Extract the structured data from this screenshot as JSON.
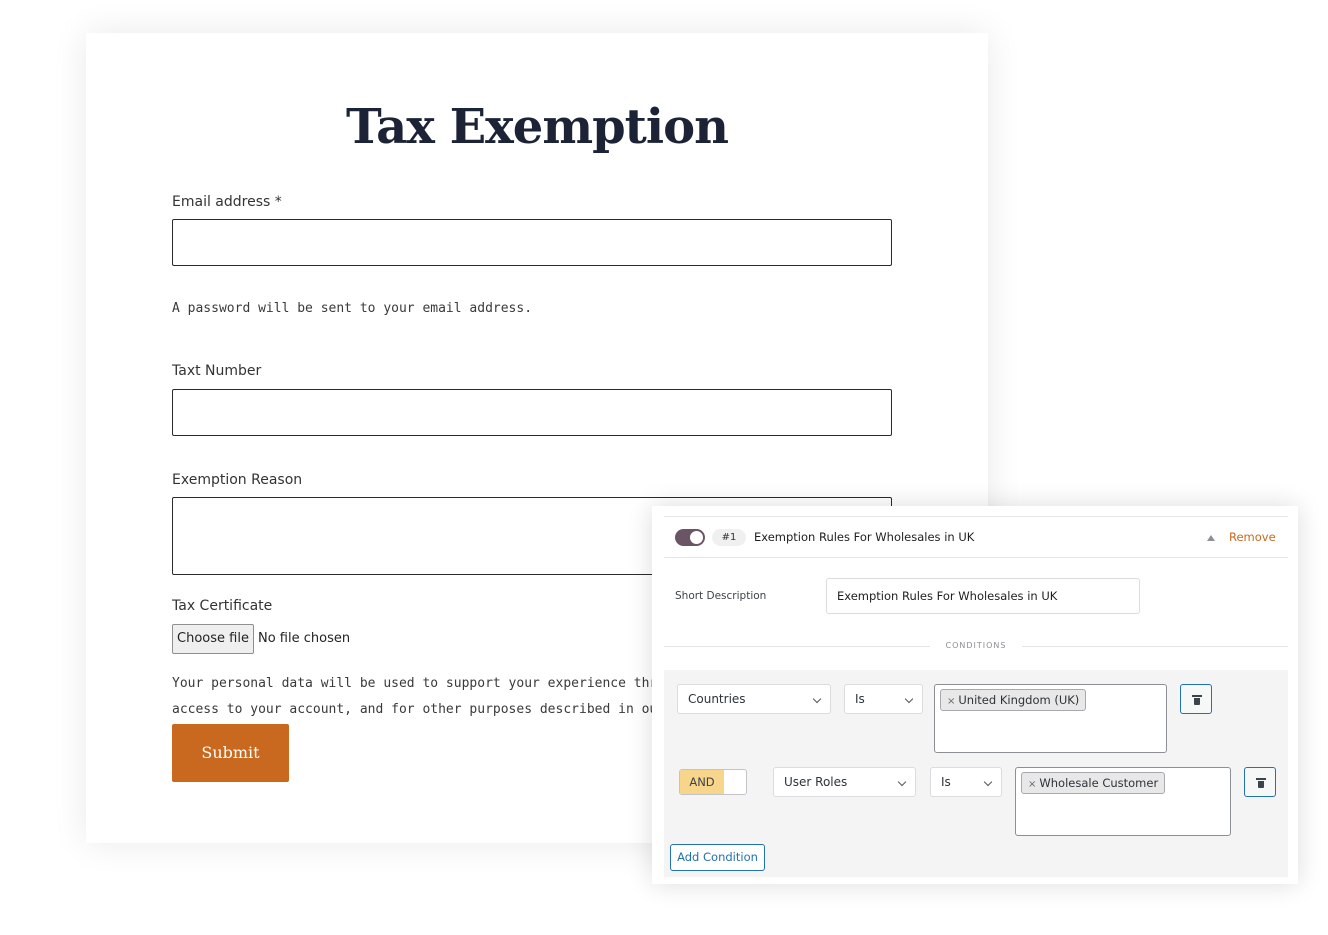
{
  "form": {
    "title": "Tax Exemption",
    "email_label": "Email address *",
    "email_value": "",
    "password_note": "A password will be sent to your email address.",
    "tax_number_label": "Taxt Number",
    "tax_number_value": "",
    "reason_label": "Exemption Reason",
    "reason_value": "",
    "certificate_label": "Tax Certificate",
    "file_button": "Choose file",
    "file_status": "No file chosen",
    "privacy_line1": "Your personal data will be used to support your experience throu",
    "privacy_line2": "access to your account, and for other purposes described in our",
    "submit_label": "Submit",
    "colors": {
      "title": "#1d2337",
      "submit_bg": "#c9691f"
    }
  },
  "rule_panel": {
    "enabled": true,
    "rule_number": "#1",
    "rule_title": "Exemption Rules For Wholesales in UK",
    "remove_label": "Remove",
    "short_description_label": "Short Description",
    "short_description_value": "Exemption Rules For Wholesales in UK",
    "conditions_label": "CONDITIONS",
    "conditions": [
      {
        "field": "Countries",
        "operator": "Is",
        "values": [
          "United Kingdom (UK)"
        ]
      },
      {
        "connector": "AND",
        "field": "User Roles",
        "operator": "Is",
        "values": [
          "Wholesale Customer"
        ]
      }
    ],
    "tag_remove_glyph": "×",
    "add_condition_label": "Add Condition",
    "colors": {
      "toggle": "#6b5466",
      "and_toggle": "#f7d58b",
      "link": "#2271b1",
      "remove": "#c9691f"
    }
  }
}
